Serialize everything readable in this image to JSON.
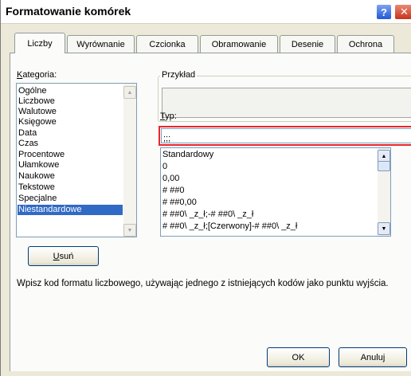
{
  "window": {
    "title": "Formatowanie komórek",
    "help_glyph": "?",
    "close_glyph": "✕"
  },
  "tabs": [
    {
      "label": "Liczby",
      "active": true
    },
    {
      "label": "Wyrównanie",
      "active": false
    },
    {
      "label": "Czcionka",
      "active": false
    },
    {
      "label": "Obramowanie",
      "active": false
    },
    {
      "label": "Desenie",
      "active": false
    },
    {
      "label": "Ochrona",
      "active": false
    }
  ],
  "category": {
    "label_underlined": "K",
    "label_rest": "ategoria:",
    "items": [
      "Ogólne",
      "Liczbowe",
      "Walutowe",
      "Księgowe",
      "Data",
      "Czas",
      "Procentowe",
      "Ułamkowe",
      "Naukowe",
      "Tekstowe",
      "Specjalne",
      "Niestandardowe"
    ],
    "selected": "Niestandardowe"
  },
  "sample": {
    "legend": "Przykład",
    "value": ""
  },
  "type": {
    "label_underlined": "T",
    "label_rest": "yp:",
    "value": ";;;"
  },
  "formats": {
    "items": [
      "Standardowy",
      "0",
      "0,00",
      "# ##0",
      "# ##0,00",
      "# ##0\\ _z_ł;-# ##0\\ _z_ł",
      "# ##0\\ _z_ł;[Czerwony]-# ##0\\ _z_ł"
    ]
  },
  "delete_button": {
    "label_underlined": "U",
    "label_rest": "suń"
  },
  "hint_text": "Wpisz kod formatu liczbowego, używając jednego z istniejących kodów jako punktu wyjścia.",
  "ok_label": "OK",
  "cancel_label": "Anuluj",
  "colors": {
    "selection": "#316ac5",
    "type_highlight_border": "#e8262e",
    "dialog_bg": "#ece9d8"
  }
}
